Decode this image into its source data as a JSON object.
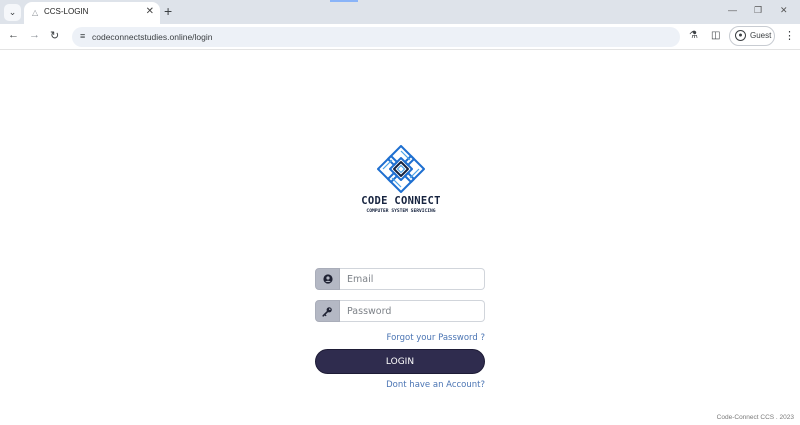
{
  "browser": {
    "tab_title": "CCS-LOGIN",
    "url": "codeconnectstudies.online/login",
    "profile_label": "Guest",
    "icons": {
      "tab_search": "chevron-down-icon",
      "favicon": "warning-icon",
      "tab_close": "close-icon",
      "new_tab": "plus-icon",
      "back": "arrow-left-icon",
      "forward": "arrow-right-icon",
      "reload": "reload-icon",
      "site_info": "tune-icon",
      "labs": "flask-icon",
      "side_panel": "side-panel-icon",
      "profile": "profile-icon",
      "menu": "kebab-menu-icon"
    }
  },
  "brand": {
    "name": "CODE CONNECT",
    "tagline": "COMPUTER SYSTEM SERVICING",
    "colors": {
      "logo_blue": "#1e6fd0",
      "logo_light": "#4aa3e8",
      "text": "#16233f"
    }
  },
  "login_form": {
    "email_placeholder": "Email",
    "password_placeholder": "Password",
    "forgot_link": "Forgot your Password ?",
    "login_button": "LOGIN",
    "signup_link": "Dont have an Account?",
    "colors": {
      "button": "#2f2c4e",
      "link": "#4a74b3",
      "addon": "#b4b8c4"
    }
  },
  "footer": {
    "text": "Code-Connect CCS . 2023"
  }
}
